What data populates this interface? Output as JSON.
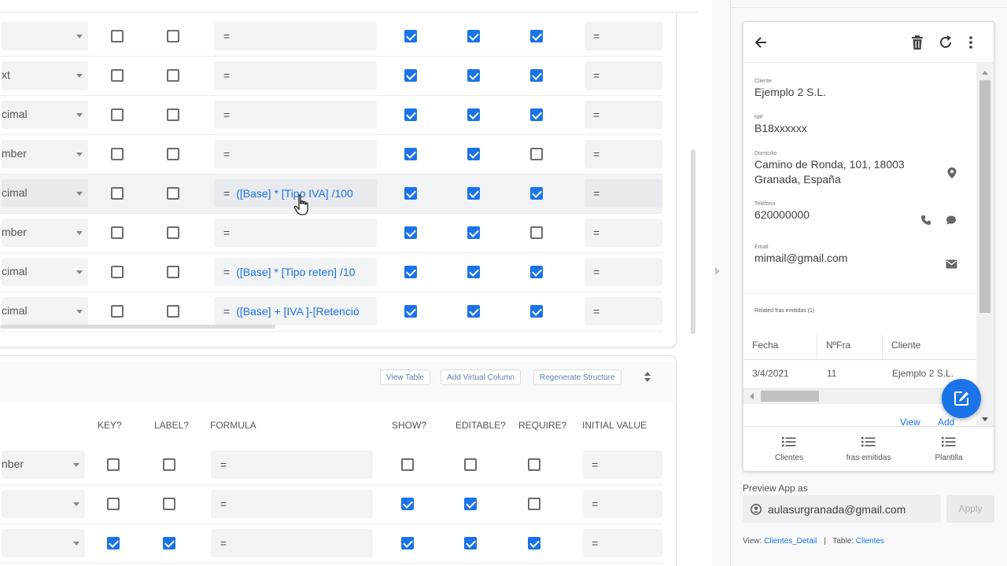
{
  "editor": {
    "top_rows": [
      {
        "type": "",
        "key": false,
        "label": false,
        "formula_prefix": "=",
        "formula": "",
        "show": true,
        "editable": true,
        "require": true,
        "initial": "=",
        "highlighted": false
      },
      {
        "type": "xt",
        "key": false,
        "label": false,
        "formula_prefix": "=",
        "formula": "",
        "show": true,
        "editable": true,
        "require": true,
        "initial": "=",
        "highlighted": false
      },
      {
        "type": "cimal",
        "key": false,
        "label": false,
        "formula_prefix": "=",
        "formula": "",
        "show": true,
        "editable": true,
        "require": true,
        "initial": "=",
        "highlighted": false
      },
      {
        "type": "mber",
        "key": false,
        "label": false,
        "formula_prefix": "=",
        "formula": "",
        "show": true,
        "editable": true,
        "require": false,
        "initial": "=",
        "highlighted": false
      },
      {
        "type": "cimal",
        "key": false,
        "label": false,
        "formula_prefix": "=",
        "formula": "([Base] * [Tipo IVA] /100",
        "show": true,
        "editable": true,
        "require": true,
        "initial": "=",
        "highlighted": true
      },
      {
        "type": "mber",
        "key": false,
        "label": false,
        "formula_prefix": "=",
        "formula": "",
        "show": true,
        "editable": true,
        "require": false,
        "initial": "=",
        "highlighted": false
      },
      {
        "type": "cimal",
        "key": false,
        "label": false,
        "formula_prefix": "=",
        "formula": "([Base] * [Tipo reten] /10",
        "show": true,
        "editable": true,
        "require": true,
        "initial": "=",
        "highlighted": false
      },
      {
        "type": "cimal",
        "key": false,
        "label": false,
        "formula_prefix": "=",
        "formula": "([Base] + [IVA ]-[Retenció",
        "show": true,
        "editable": true,
        "require": true,
        "initial": "=",
        "highlighted": false
      }
    ],
    "buttons": {
      "view_table": "View Table",
      "add_virtual_column": "Add Virtual Column",
      "regenerate_structure": "Regenerate Structure"
    },
    "columns": {
      "key": "KEY?",
      "label": "LABEL?",
      "formula": "FORMULA",
      "show": "SHOW?",
      "editable": "EDITABLE?",
      "require": "REQUIRE?",
      "initial_value": "INITIAL VALUE"
    },
    "bottom_rows": [
      {
        "type": "nber",
        "key": false,
        "label": false,
        "formula_prefix": "=",
        "formula": "",
        "show": false,
        "editable": false,
        "require": false,
        "initial": "="
      },
      {
        "type": "",
        "key": false,
        "label": false,
        "formula_prefix": "=",
        "formula": "",
        "show": true,
        "editable": true,
        "require": false,
        "initial": "="
      },
      {
        "type": "",
        "key": true,
        "label": true,
        "formula_prefix": "=",
        "formula": "",
        "show": true,
        "editable": true,
        "require": true,
        "initial": "="
      }
    ]
  },
  "preview": {
    "detail": {
      "fields": [
        {
          "label": "Cliente",
          "value": "Ejemplo 2 S.L."
        },
        {
          "label": "NIF",
          "value": "B18xxxxxx"
        },
        {
          "label": "Domicilio",
          "value_line1": "Camino de Ronda, 101, 18003",
          "value_line2": "Granada, España",
          "action_icon": "location-pin-icon"
        },
        {
          "label": "Teléfono",
          "value": "620000000",
          "action_icons": [
            "phone-icon",
            "chat-icon"
          ]
        },
        {
          "label": "Email",
          "value": "mimail@gmail.com",
          "action_icon": "mail-icon"
        }
      ],
      "related": {
        "title": "Related fras emitidas (1)",
        "headers": [
          "Fecha",
          "NºFra",
          "Cliente"
        ],
        "rows": [
          [
            "3/4/2021",
            "11",
            "Ejemplo 2 S.L."
          ]
        ],
        "view_link": "View",
        "add_link": "Add"
      }
    },
    "nav": [
      {
        "label": "Clientes",
        "icon": "list-icon"
      },
      {
        "label": "fras emitidas",
        "icon": "list-icon"
      },
      {
        "label": "Plantilla",
        "icon": "list-icon"
      }
    ],
    "preview_as_label": "Preview App as",
    "email": "aulasurgranada@gmail.com",
    "apply": "Apply",
    "view_prefix": "View:",
    "view_name": "Clientes_Detail",
    "table_prefix": "Table:",
    "table_name": "Clientes",
    "separator": "|"
  },
  "colors": {
    "accent": "#1a73e8",
    "fab": "#1a73e8"
  }
}
